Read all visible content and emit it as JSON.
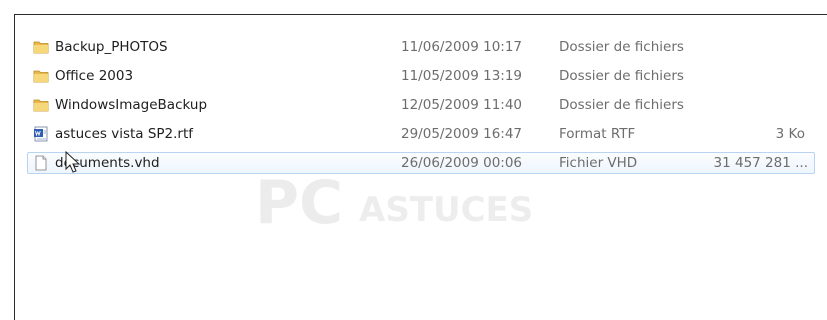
{
  "files": [
    {
      "name": "Backup_PHOTOS",
      "date": "11/06/2009 10:17",
      "type": "Dossier de fichiers",
      "size": "",
      "icon": "folder-icon"
    },
    {
      "name": "Office 2003",
      "date": "11/05/2009 13:19",
      "type": "Dossier de fichiers",
      "size": "",
      "icon": "folder-icon"
    },
    {
      "name": "WindowsImageBackup",
      "date": "12/05/2009 11:40",
      "type": "Dossier de fichiers",
      "size": "",
      "icon": "folder-icon"
    },
    {
      "name": "astuces vista SP2.rtf",
      "date": "29/05/2009 16:47",
      "type": "Format RTF",
      "size": "3 Ko",
      "icon": "rtf-document-icon"
    },
    {
      "name": "documents.vhd",
      "date": "26/06/2009 00:06",
      "type": "Fichier VHD",
      "size": "31 457 281 ...",
      "icon": "blank-file-icon",
      "selected": true
    }
  ],
  "watermark": {
    "text_big": "PC",
    "text_small": "ASTUCES"
  },
  "colors": {
    "selection_border": "#b8d4f0",
    "folder": "#e8b84a",
    "secondary_text": "#6d6d6d"
  }
}
